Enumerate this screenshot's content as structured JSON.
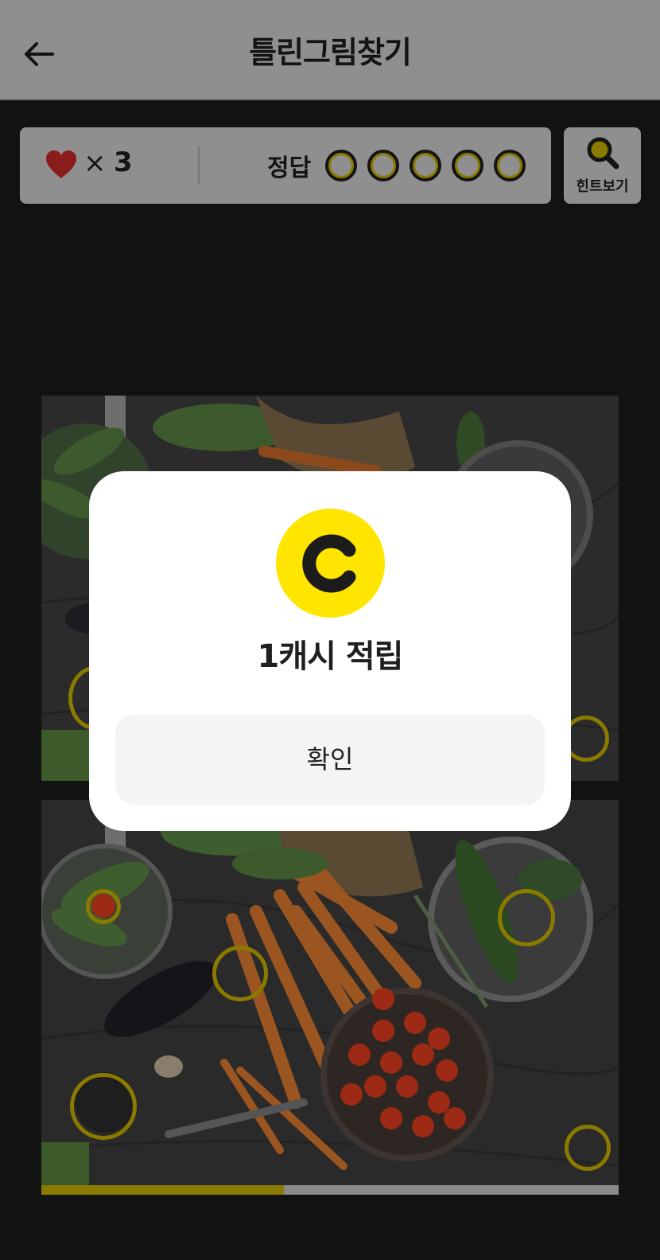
{
  "header": {
    "title": "틀린그림찾기",
    "back_icon": "arrow-left-icon"
  },
  "status": {
    "lives_symbol": "×",
    "lives_count": "3",
    "answer_label": "정답",
    "answers_found": 0,
    "answers_total": 5
  },
  "hint": {
    "label": "힌트보기",
    "icon": "magnifier-icon"
  },
  "game": {
    "progress": 0.42
  },
  "modal": {
    "title": "1캐시 적립",
    "confirm_label": "확인",
    "coin_icon": "cash-coin-icon"
  },
  "colors": {
    "coin": "#ffe500",
    "marker": "#8a7a00",
    "heart": "#8a1c1c"
  }
}
